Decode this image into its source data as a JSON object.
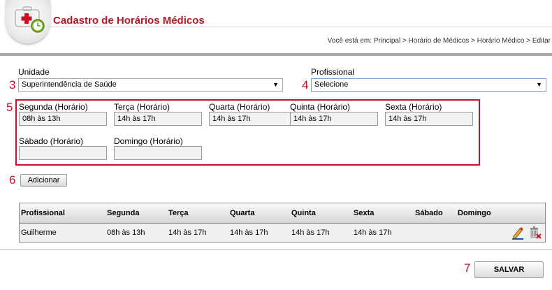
{
  "header": {
    "title": "Cadastro de Horários Médicos",
    "breadcrumb": "Você está em: Principal > Horário de Médicos > Horário Médico > Editar"
  },
  "form": {
    "unidade": {
      "label": "Unidade",
      "value": "Superintendência de Saúde",
      "marker": "3"
    },
    "profissional": {
      "label": "Profissional",
      "value": "Selecione",
      "marker": "4"
    },
    "schedule_marker": "5",
    "days": [
      {
        "label": "Segunda (Horário)",
        "value": "08h às 13h"
      },
      {
        "label": "Terça (Horário)",
        "value": "14h às 17h"
      },
      {
        "label": "Quarta (Horário)",
        "value": "14h às 17h"
      },
      {
        "label": "Quinta (Horário)",
        "value": "14h às 17h"
      },
      {
        "label": "Sexta (Horário)",
        "value": "14h às 17h"
      },
      {
        "label": "Sábado (Horário)",
        "value": ""
      },
      {
        "label": "Domingo (Horário)",
        "value": ""
      }
    ],
    "add_button": {
      "label": "Adicionar",
      "marker": "6"
    }
  },
  "table": {
    "columns": [
      "Profissional",
      "Segunda",
      "Terça",
      "Quarta",
      "Quinta",
      "Sexta",
      "Sábado",
      "Domingo"
    ],
    "rows": [
      {
        "cells": [
          "Guilherme",
          "08h às 13h",
          "14h às 17h",
          "14h às 17h",
          "14h às 17h",
          "14h às 17h",
          "",
          ""
        ]
      }
    ],
    "icons": [
      "edit-pencil-icon",
      "delete-trash-icon"
    ]
  },
  "footer": {
    "save_button": {
      "label": "SALVAR",
      "marker": "7"
    }
  },
  "colors": {
    "title": "#b0182a",
    "marker": "#c8102e"
  }
}
